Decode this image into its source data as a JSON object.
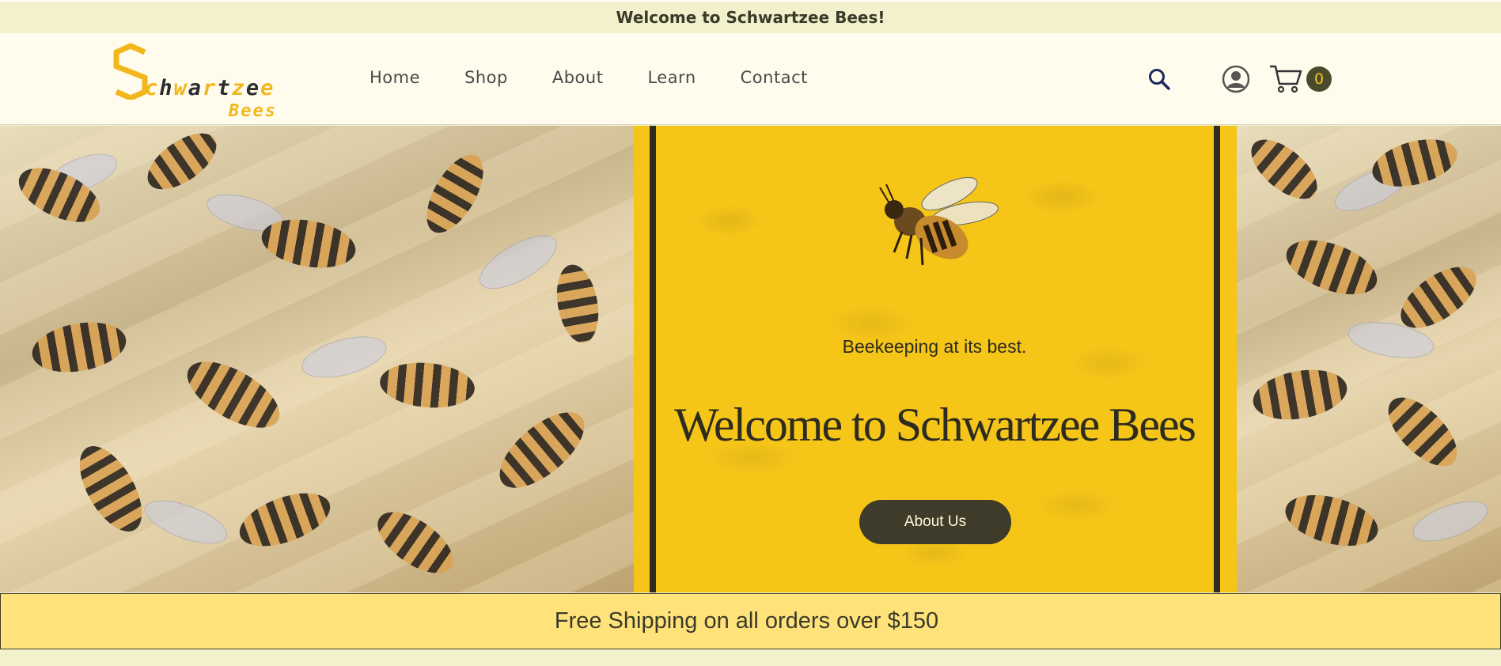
{
  "top_banner": {
    "text": "Welcome to Schwartzee Bees!"
  },
  "header": {
    "logo": {
      "letters": [
        "S",
        "c",
        "h",
        "w",
        "a",
        "r",
        "t",
        "z",
        "e",
        "e"
      ],
      "sub": "Bees"
    },
    "nav": [
      "Home",
      "Shop",
      "About",
      "Learn",
      "Contact"
    ],
    "icons": {
      "search": "search-icon",
      "account": "user-account-icon",
      "cart": "shopping-cart-icon"
    },
    "cart_count": "0"
  },
  "hero": {
    "tagline": "Beekeeping at its best.",
    "title": "Welcome to Schwartzee Bees",
    "cta_label": "About Us",
    "panel_color": "#F5C518",
    "border_color": "#2E2B1F"
  },
  "shipping_banner": {
    "text": "Free Shipping on all orders over $150"
  },
  "colors": {
    "brand_yellow": "#F2B71C",
    "banner_bg": "#F3F1CC",
    "header_bg": "#FFFCEE",
    "dark": "#3E3B2B",
    "shipping_bg": "#FFE37A"
  }
}
